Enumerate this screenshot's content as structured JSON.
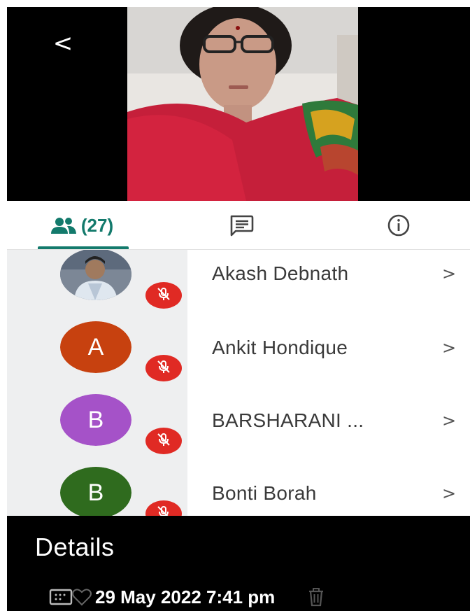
{
  "header": {
    "back_glyph": "<",
    "back_icon": "chevron-left-icon"
  },
  "tabs": [
    {
      "icon": "people-icon",
      "label": "(27)",
      "active": true
    },
    {
      "icon": "chat-icon",
      "label": "",
      "active": false
    },
    {
      "icon": "info-icon",
      "label": "",
      "active": false
    }
  ],
  "participants": [
    {
      "name": "Akash Debnath",
      "avatar_type": "photo",
      "avatar_letter": "",
      "avatar_color": "#6f7d8f",
      "muted": true,
      "chevron": ">"
    },
    {
      "name": "Ankit Hondique",
      "avatar_type": "letter",
      "avatar_letter": "A",
      "avatar_color": "#c7410f",
      "muted": true,
      "chevron": ">"
    },
    {
      "name": "BARSHARANI ...",
      "avatar_type": "letter",
      "avatar_letter": "B",
      "avatar_color": "#a552c8",
      "muted": true,
      "chevron": ">"
    },
    {
      "name": "Bonti Borah",
      "avatar_type": "letter",
      "avatar_letter": "B",
      "avatar_color": "#2f6b1e",
      "muted": true,
      "chevron": ">"
    }
  ],
  "details": {
    "title": "Details",
    "datetime": "29 May 2022 7:41 pm",
    "icons": [
      "image-icon",
      "heart-icon",
      "share-icon",
      "edit-icon",
      "trash-icon"
    ]
  },
  "colors": {
    "accent": "#137a6c",
    "mute_badge": "#e02a24",
    "list_left_bg": "#eeeff0"
  }
}
